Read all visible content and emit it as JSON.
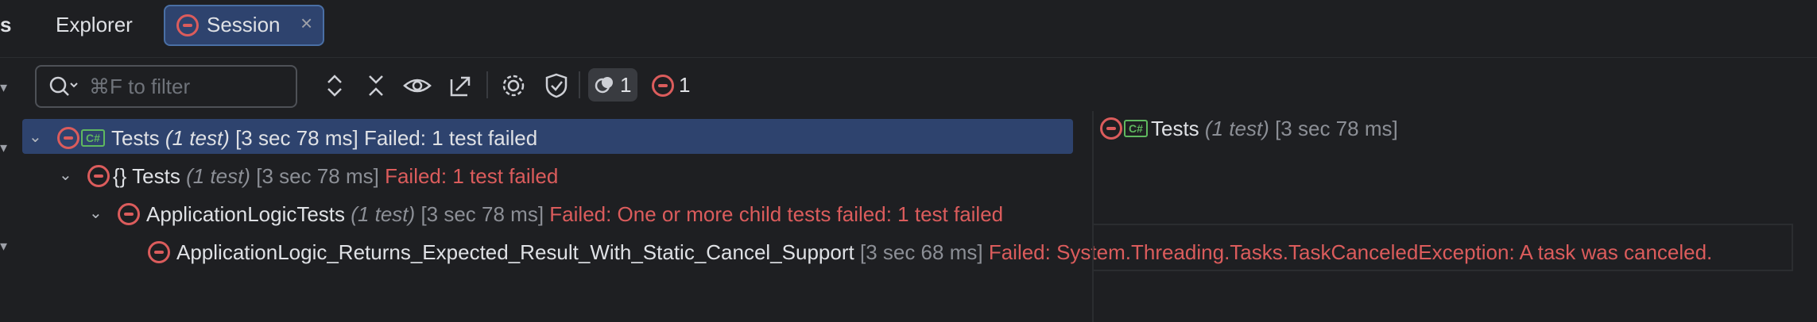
{
  "tabs": {
    "partial": "s",
    "explorer": "Explorer",
    "session": "Session",
    "session_close": "×"
  },
  "toolbar": {
    "filter_placeholder": "⌘F to filter",
    "running_count": "1",
    "failed_count": "1"
  },
  "tree": [
    {
      "name": "Tests",
      "count": "(1 test)",
      "time": "[3 sec 78 ms]",
      "status": "Failed: 1 test failed"
    },
    {
      "name": "Tests",
      "ns_prefix": "{}",
      "count": "(1 test)",
      "time": "[3 sec 78 ms]",
      "status": "Failed: 1 test failed"
    },
    {
      "name": "ApplicationLogicTests",
      "count": "(1 test)",
      "time": "[3 sec 78 ms]",
      "status": "Failed: One or more child tests failed: 1 test failed"
    },
    {
      "name": "ApplicationLogic_Returns_Expected_Result_With_Static_Cancel_Support",
      "time": "[3 sec 68 ms]",
      "status": "Failed: System.Threading.Tasks.TaskCanceledException: A task was canceled."
    }
  ],
  "details": {
    "name": "Tests",
    "count": "(1 test)",
    "time": "[3 sec 78 ms]"
  },
  "badges": {
    "csharp": "C#"
  },
  "colors": {
    "failed": "#db5c5c",
    "selected_bg": "#2e436e",
    "background": "#1e1f22"
  }
}
